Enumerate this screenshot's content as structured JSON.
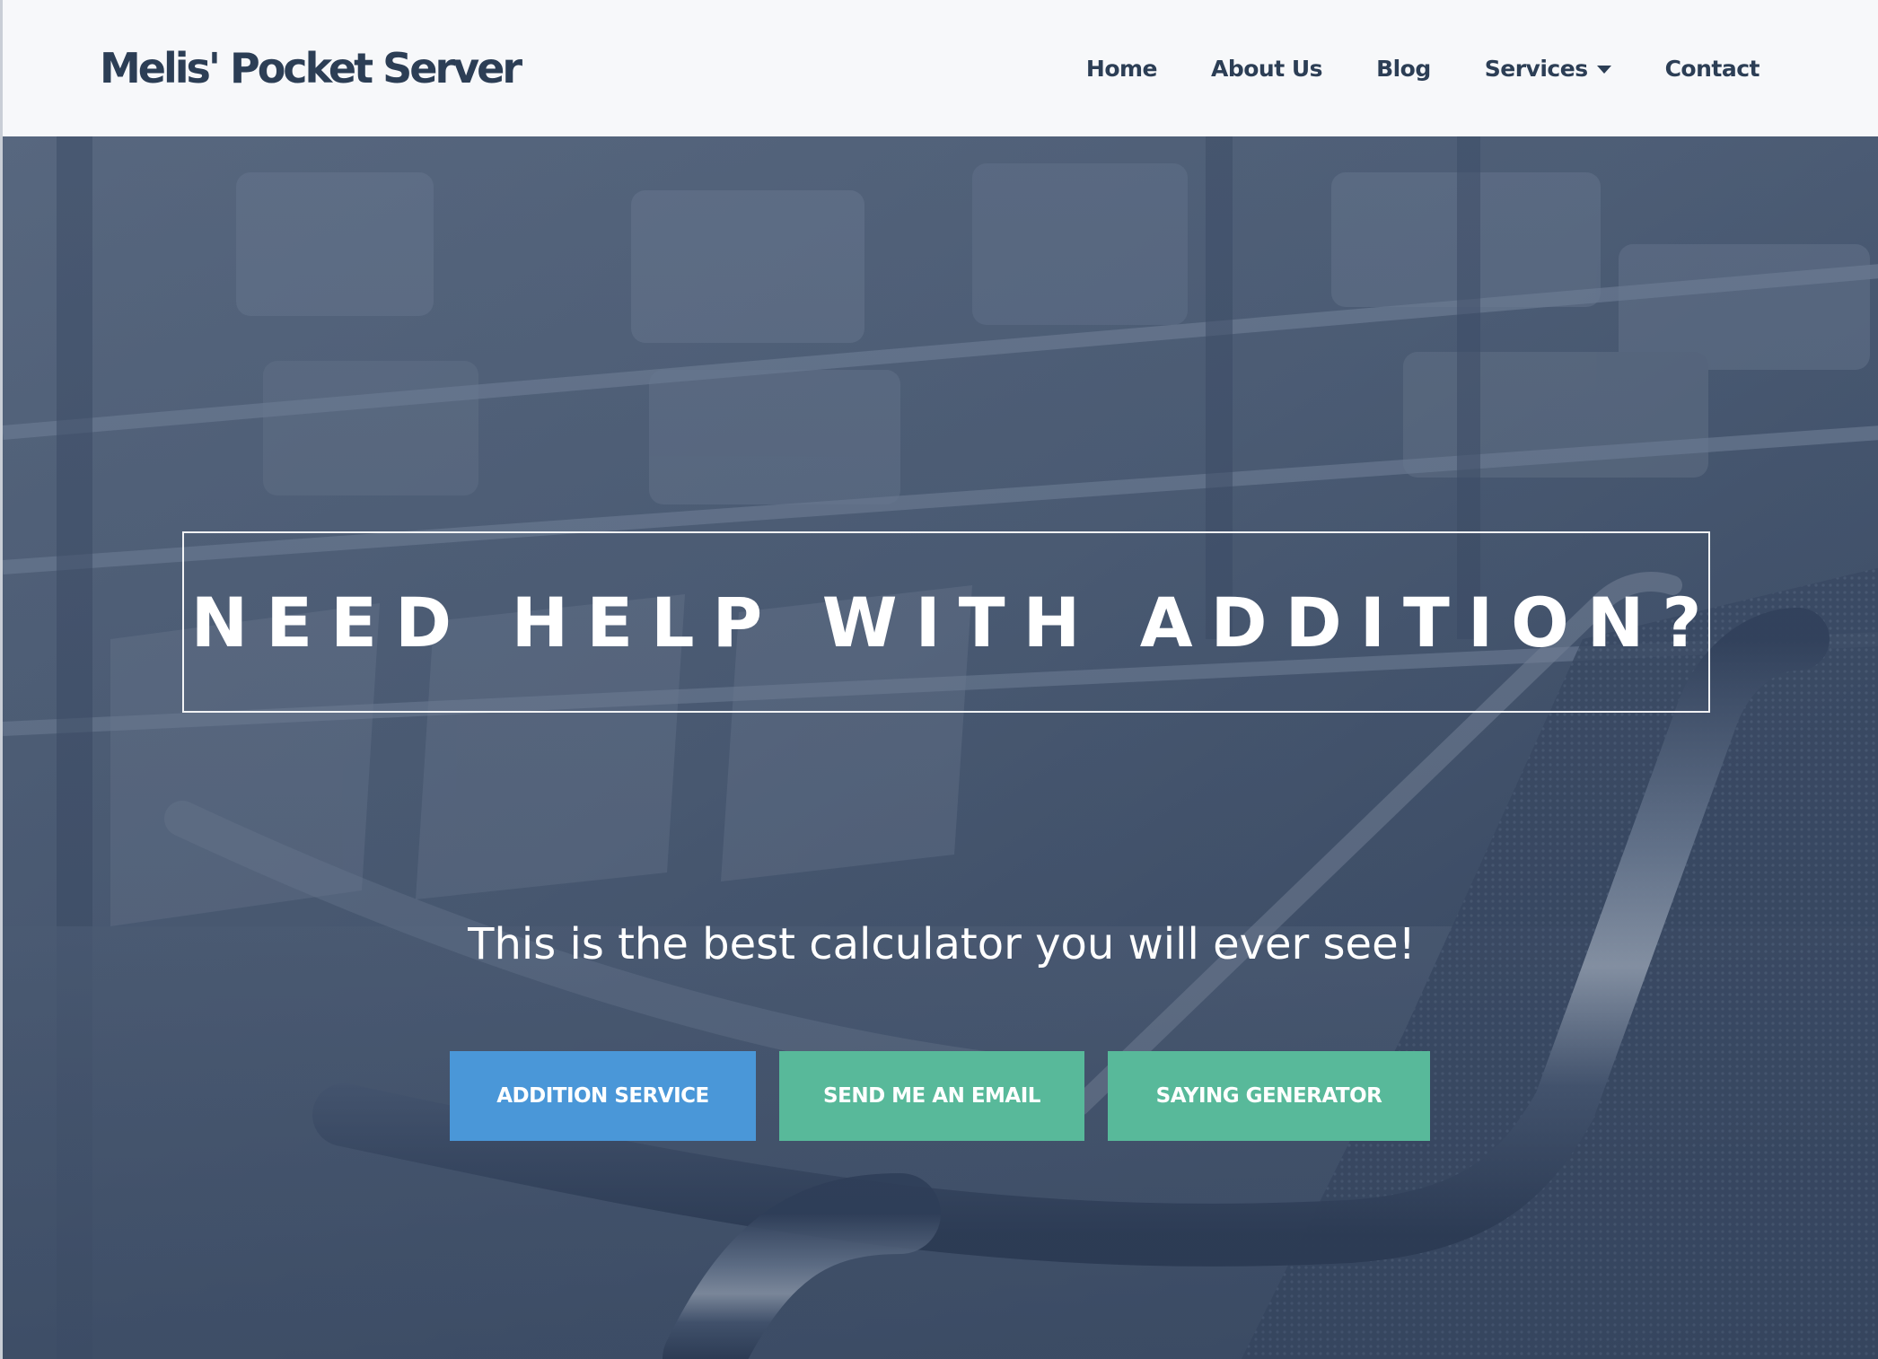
{
  "navbar": {
    "brand": "Melis' Pocket Server",
    "links": [
      {
        "label": "Home"
      },
      {
        "label": "About Us"
      },
      {
        "label": "Blog"
      },
      {
        "label": "Services",
        "has_dropdown": true
      },
      {
        "label": "Contact"
      }
    ]
  },
  "hero": {
    "headline": "NEED HELP WITH ADDITION?",
    "subtitle": "This is the best calculator you will ever see!",
    "buttons": [
      {
        "label": "ADDITION SERVICE",
        "color": "#4a97d8"
      },
      {
        "label": "SEND ME AN EMAIL",
        "color": "#58b99a"
      },
      {
        "label": "SAYING GENERATOR",
        "color": "#58b99a"
      }
    ]
  },
  "colors": {
    "brand_text": "#2c3e55",
    "navbar_bg": "#f7f8fa",
    "hero_overlay": "#4f5f77",
    "primary_button": "#4a97d8",
    "secondary_button": "#58b99a"
  }
}
